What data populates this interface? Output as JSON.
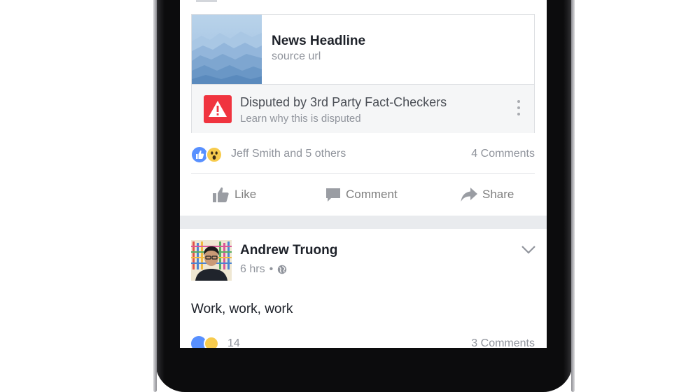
{
  "link_card": {
    "headline": "News Headline",
    "source": "source url",
    "dispute_title": "Disputed by 3rd Party Fact-Checkers",
    "dispute_subtitle": "Learn why this is disputed",
    "warning_icon": "warning-triangle-icon",
    "warning_color": "#f0343f"
  },
  "reactions": {
    "icons": [
      "like-reaction-icon",
      "wow-reaction-icon"
    ],
    "names": "Jeff Smith and 5 others",
    "comments": "4 Comments"
  },
  "actions": [
    {
      "label": "Like",
      "icon": "thumbs-up-icon"
    },
    {
      "label": "Comment",
      "icon": "comment-bubble-icon"
    },
    {
      "label": "Share",
      "icon": "share-arrow-icon"
    }
  ],
  "post": {
    "author": "Andrew Truong",
    "time": "6 hrs",
    "separator": "•",
    "privacy_icon": "globe-icon",
    "text": "Work, work, work",
    "reaction_count": "14",
    "comments": "3 Comments"
  },
  "colors": {
    "brand_blue": "#5890ff",
    "text_primary": "#1d2129",
    "text_secondary": "#90949c"
  }
}
